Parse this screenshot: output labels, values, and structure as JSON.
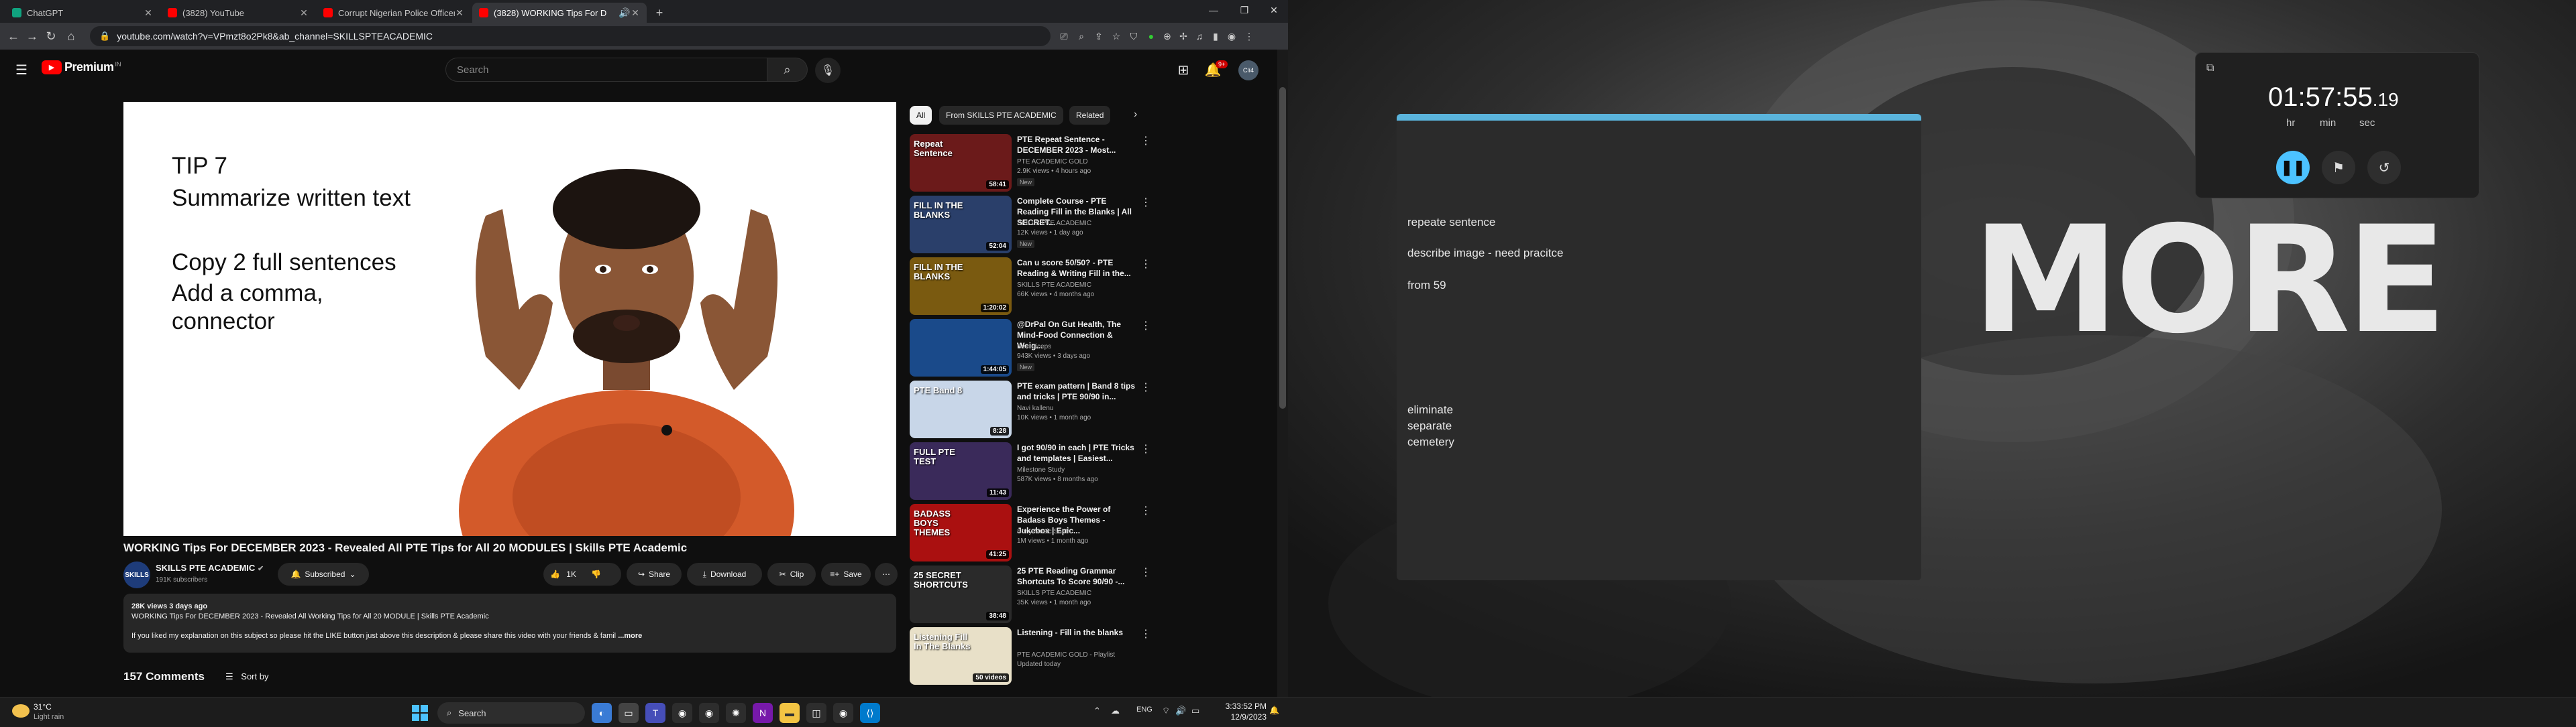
{
  "browser": {
    "tabs": [
      {
        "title": "ChatGPT",
        "icon": "chatgpt-icon",
        "color": "#10a37f"
      },
      {
        "title": "(3828) YouTube",
        "icon": "youtube-icon",
        "color": "#ff0000"
      },
      {
        "title": "Corrupt Nigerian Police Officer -",
        "icon": "youtube-icon",
        "color": "#ff0000"
      },
      {
        "title": "(3828) WORKING Tips For D",
        "icon": "youtube-icon",
        "color": "#ff0000"
      }
    ],
    "new_tab": "+",
    "url": "youtube.com/watch?v=VPmzt8o2Pk8&ab_channel=SKILLSPTEACADEMIC"
  },
  "youtube": {
    "logo": "Premium",
    "logo_sup": "IN",
    "search_placeholder": "Search",
    "notifications_count": "9+",
    "avatar_initials": "Clí4",
    "video_overlay": {
      "lines": [
        "TIP 7",
        "Summarize written text",
        "",
        "Copy 2 full sentences",
        "Add a comma,",
        "connector"
      ]
    },
    "video_title": "WORKING Tips For DECEMBER 2023 - Revealed All PTE Tips for All 20 MODULES | Skills PTE Academic",
    "channel": {
      "name": "SKILLS PTE ACADEMIC",
      "subscribers": "191K subscribers",
      "avatar_text": "SKILLS"
    },
    "actions": {
      "subscribed": "Subscribed",
      "likes": "1K",
      "share": "Share",
      "download": "Download",
      "clip": "Clip",
      "save": "Save"
    },
    "description": {
      "meta": "28K views  3 days ago",
      "line1": "WORKING Tips For DECEMBER 2023 - Revealed All Working Tips for All 20 MODULE | Skills PTE Academic",
      "line2": "If you liked my explanation on this subject so please hit the LIKE button just above this description & please share this video with your friends & famil",
      "more": "...more"
    },
    "comments": {
      "count": "157 Comments",
      "sort": "Sort by"
    },
    "chips": [
      "All",
      "From SKILLS PTE ACADEMIC",
      "Related"
    ],
    "recommendations": [
      {
        "title": "PTE Repeat Sentence - DECEMBER 2023 - Most...",
        "channel": "PTE ACADEMIC GOLD",
        "views": "2.9K views • 4 hours ago",
        "badge": "New",
        "duration": "58:41",
        "thumb_text": "Repeat Sentence",
        "bg": "#6b1a1a"
      },
      {
        "title": "Complete Course - PTE Reading Fill in the Blanks | All SECRET...",
        "channel": "SKILLS PTE ACADEMIC",
        "views": "12K views • 1 day ago",
        "badge": "New",
        "duration": "52:04",
        "thumb_text": "FILL IN THE BLANKS",
        "bg": "#2a3f6a"
      },
      {
        "title": "Can u score 50/50? - PTE Reading & Writing Fill in the...",
        "channel": "SKILLS PTE ACADEMIC",
        "views": "66K views • 4 months ago",
        "badge": "",
        "duration": "1:20:02",
        "thumb_text": "FILL IN THE BLANKS",
        "bg": "#7a5a10"
      },
      {
        "title": "@DrPal On Gut Health, The Mind-Food Connection & Weig...",
        "channel": "BeerBiceps",
        "views": "943K views • 3 days ago",
        "badge": "New",
        "duration": "1:44:05",
        "thumb_text": "",
        "bg": "#1a4a8a"
      },
      {
        "title": "PTE exam pattern | Band 8 tips and tricks | PTE 90/90 in...",
        "channel": "Navi kallenu",
        "views": "10K views • 1 month ago",
        "badge": "",
        "duration": "8:28",
        "thumb_text": "PTE Band 8",
        "bg": "#c8d6e8"
      },
      {
        "title": "I got 90/90 in each | PTE Tricks and templates | Easiest...",
        "channel": "Milestone Study",
        "views": "587K views • 8 months ago",
        "badge": "",
        "duration": "11:43",
        "thumb_text": "FULL PTE TEST",
        "bg": "#3a2a5a"
      },
      {
        "title": "Experience the Power of Badass Boys Themes - Jukebox | Epic...",
        "channel": "Sony Music South",
        "views": "1M views • 1 month ago",
        "badge": "",
        "duration": "41:25",
        "thumb_text": "BADASS BOYS THEMES",
        "bg": "#aa1010"
      },
      {
        "title": "25 PTE Reading Grammar Shortcuts To Score 90/90 -...",
        "channel": "SKILLS PTE ACADEMIC",
        "views": "35K views • 1 month ago",
        "badge": "",
        "duration": "38:48",
        "thumb_text": "25 SECRET SHORTCUTS",
        "bg": "#2a2a2a"
      },
      {
        "title": "Listening - Fill in the blanks",
        "channel": "PTE ACADEMIC GOLD - Playlist",
        "views": "Updated today",
        "badge": "",
        "duration": "50 videos",
        "thumb_text": "Listening Fill In The Blanks",
        "bg": "#e8e0c8"
      }
    ]
  },
  "notes": {
    "lines": [
      "repeate sentence",
      "describe image    -    need pracitce",
      "from 59",
      "eliminate",
      "separate",
      "cemetery"
    ]
  },
  "clock": {
    "time": "01:57:55",
    "fraction": ".19",
    "units": [
      "hr",
      "min",
      "sec"
    ]
  },
  "desktop": {
    "wallpaper_text": "MORE"
  },
  "taskbar": {
    "temp": "31°C",
    "weather": "Light rain",
    "search": "Search",
    "lang": "ENG",
    "time": "3:33:52 PM",
    "date": "12/9/2023"
  }
}
